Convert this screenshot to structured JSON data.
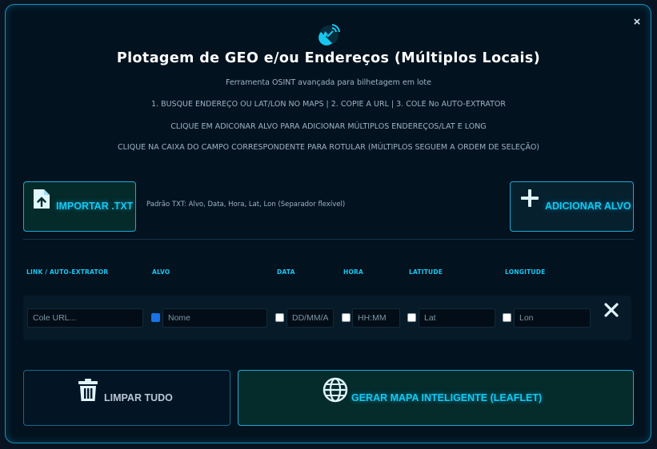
{
  "header": {
    "title": "Plotagem de GEO e/ou Endereços (Múltiplos Locais)",
    "subtitle": "Ferramenta OSINT avançada para bilhetagem em lote",
    "instructions": [
      "1. BUSQUE ENDEREÇO OU LAT/LON NO MAPS | 2. COPIE A URL | 3. COLE No AUTO-EXTRATOR",
      "CLIQUE EM ADICONAR ALVO PARA ADICIONAR MÚLTIPLOS ENDEREÇOS/LAT E LONG",
      "CLIQUE NA CAIXA DO CAMPO CORRESPONDENTE PARA ROTULAR (MÚLTIPLOS SEGUEM A ORDEM DE SELEÇÃO)"
    ],
    "close_label": "×"
  },
  "toolbar": {
    "import_label": "IMPORTAR .TXT",
    "import_hint": "Padrão TXT: Alvo, Data, Hora, Lat, Lon (Separador flexível)",
    "add_label": "ADICIONAR ALVO"
  },
  "columns": [
    "LINK / AUTO-EXTRATOR",
    "ALVO",
    "DATA",
    "HORA",
    "LATITUDE",
    "LONGITUDE"
  ],
  "row": {
    "link_placeholder": "Cole URL...",
    "alvo_placeholder": "Nome",
    "data_placeholder": "DD/MM/AAAA",
    "hora_placeholder": "HH:MM",
    "lat_placeholder": "Lat",
    "lon_placeholder": "Lon",
    "alvo_checked": true,
    "data_checked": false,
    "hora_checked": false,
    "lat_checked": false,
    "lon_checked": false
  },
  "footer": {
    "clear_label": "LIMPAR TUDO",
    "generate_label": "GERAR MAPA INTELIGENTE (LEAFLET)"
  },
  "icons": {
    "header": "satellite-dish-icon",
    "import": "file-upload-icon",
    "add": "plus-icon",
    "remove_row": "close-x-icon",
    "clear": "trash-icon",
    "generate": "globe-icon"
  },
  "colors": {
    "accent": "#19c6ee",
    "border": "#1ea8d6",
    "background": "#03121f",
    "checkbox_checked": "#1a73e8"
  }
}
